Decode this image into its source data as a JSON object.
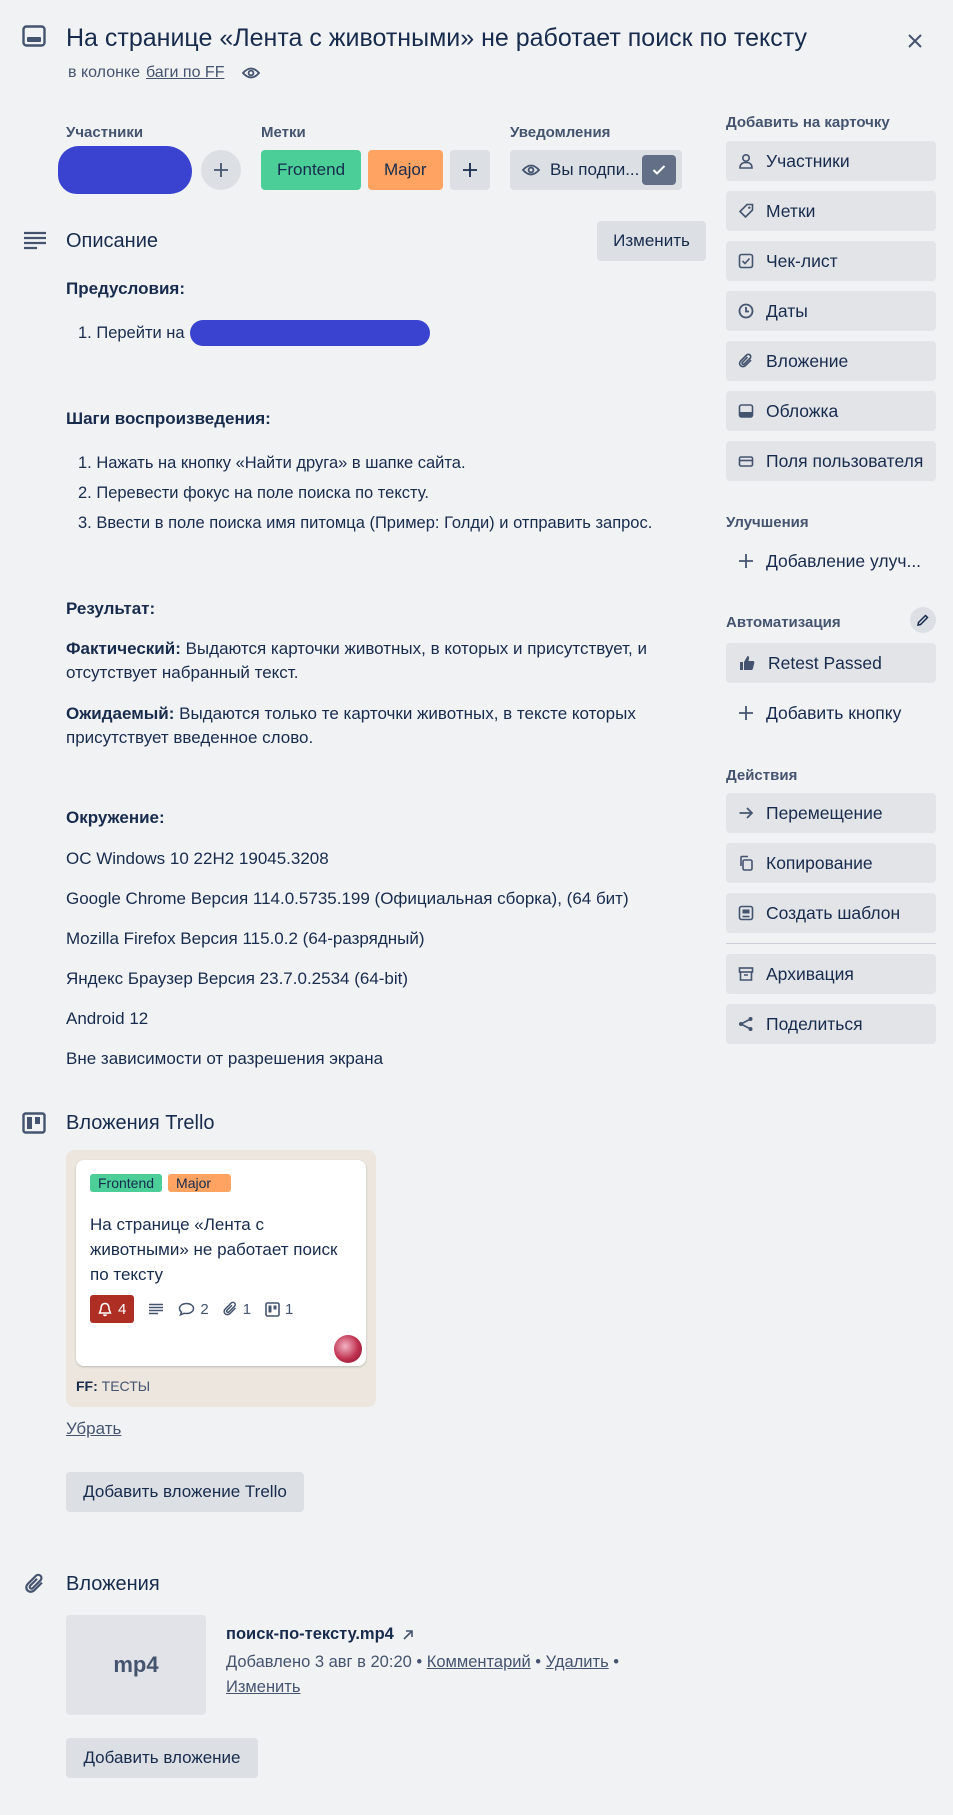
{
  "card": {
    "title": "На странице «Лента с животными» не работает поиск по тексту",
    "in_column_prefix": "в колонке",
    "column_name": "баги по FF"
  },
  "fields": {
    "members_label": "Участники",
    "labels_label": "Метки",
    "notifications_label": "Уведомления",
    "labels": [
      {
        "name": "Frontend",
        "color": "#4bce97"
      },
      {
        "name": "Major",
        "color": "#fea362"
      }
    ],
    "watch_text": "Вы подпи..."
  },
  "description": {
    "title": "Описание",
    "edit_label": "Изменить",
    "preconditions_title": "Предусловия:",
    "preconditions": [
      "1. Перейти на"
    ],
    "steps_title": "Шаги воспроизведения:",
    "steps": [
      "1. Нажать на кнопку «Найти друга» в шапке сайта.",
      "2. Перевести фокус на поле поиска по тексту.",
      "3. Ввести в поле поиска имя питомца (Пример: Голди) и отправить запрос."
    ],
    "result_title": "Результат:",
    "actual_label": "Фактический:",
    "actual_text": " Выдаются карточки животных, в которых и присутствует, и отсутствует набранный текст.",
    "expected_label": "Ожидаемый:",
    "expected_text": " Выдаются только те карточки животных, в тексте которых присутствует введенное слово.",
    "env_title": "Окружение:",
    "env": [
      "ОС Windows 10 22H2 19045.3208",
      "Google Chrome Версия 114.0.5735.199 (Официальная сборка), (64 бит)",
      "Mozilla Firefox Версия 115.0.2 (64-разрядный)",
      "Яндекс Браузер Версия 23.7.0.2534 (64-bit)",
      "Android 12",
      "Вне зависимости от разрешения экрана"
    ]
  },
  "trello_attachments": {
    "title": "Вложения Trello",
    "card_labels": [
      "Frontend",
      "Major"
    ],
    "card_title": "На странице «Лента с животными» не работает поиск по тексту",
    "badges": {
      "notifications": "4",
      "comments": "2",
      "attachments": "1",
      "checklist": "1"
    },
    "board_prefix": "FF:",
    "board_name": "ТЕСТЫ",
    "remove_label": "Убрать",
    "add_label": "Добавить вложение Trello"
  },
  "attachments": {
    "title": "Вложения",
    "thumb_ext": "mp4",
    "file_name": "поиск-по-тексту.mp4",
    "added_text": "Добавлено 3 авг в 20:20",
    "comment_link": "Комментарий",
    "delete_link": "Удалить",
    "edit_link": "Изменить",
    "sep": "•",
    "add_label": "Добавить вложение"
  },
  "sidebar": {
    "add_to_card_title": "Добавить на карточку",
    "add_items": [
      {
        "label": "Участники",
        "icon": "person-icon"
      },
      {
        "label": "Метки",
        "icon": "tag-icon"
      },
      {
        "label": "Чек-лист",
        "icon": "checkbox-icon"
      },
      {
        "label": "Даты",
        "icon": "clock-icon"
      },
      {
        "label": "Вложение",
        "icon": "paperclip-icon"
      },
      {
        "label": "Обложка",
        "icon": "cover-icon"
      },
      {
        "label": "Поля пользователя",
        "icon": "custom-fields-icon"
      }
    ],
    "powerups_title": "Улучшения",
    "add_powerup": "Добавление улуч...",
    "automation_title": "Автоматизация",
    "retest_label": "Retest Passed",
    "add_button_label": "Добавить кнопку",
    "actions_title": "Действия",
    "actions": [
      {
        "label": "Перемещение",
        "icon": "arrow-right-icon"
      },
      {
        "label": "Копирование",
        "icon": "copy-icon"
      },
      {
        "label": "Создать шаблон",
        "icon": "template-icon"
      }
    ],
    "archive_label": "Архивация",
    "share_label": "Поделиться"
  }
}
